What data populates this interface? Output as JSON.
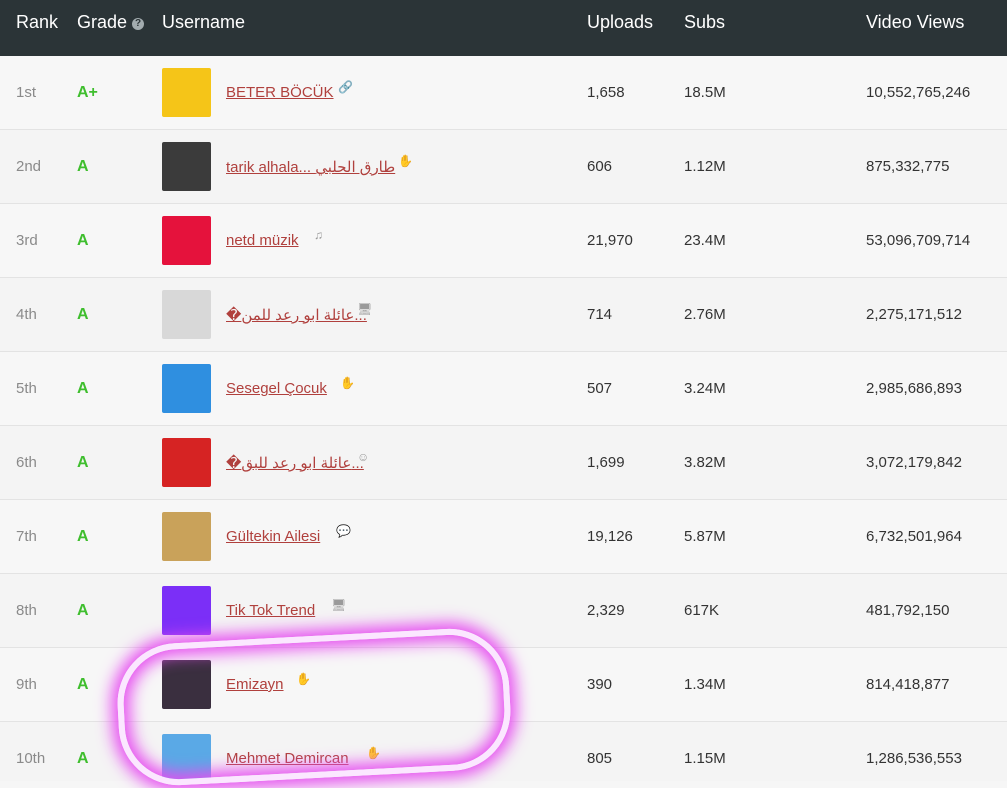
{
  "header": {
    "rank": "Rank",
    "grade": "Grade",
    "username": "Username",
    "uploads": "Uploads",
    "subs": "Subs",
    "views": "Video Views"
  },
  "rows": [
    {
      "rank": "1st",
      "grade": "A+",
      "username": "BETER BÖCÜK",
      "uploads": "1,658",
      "subs": "18.5M",
      "views": "10,552,765,246",
      "category_icon": "link-icon",
      "avatar_color": "#f5c518"
    },
    {
      "rank": "2nd",
      "grade": "A",
      "username": "tarik alhala... طارق الحلبي",
      "uploads": "606",
      "subs": "1.12M",
      "views": "875,332,775",
      "category_icon": "hand-icon",
      "avatar_color": "#3b3b3b"
    },
    {
      "rank": "3rd",
      "grade": "A",
      "username": "netd müzik",
      "uploads": "21,970",
      "subs": "23.4M",
      "views": "53,096,709,714",
      "category_icon": "music-icon",
      "avatar_color": "#e5123c"
    },
    {
      "rank": "4th",
      "grade": "A",
      "username": "�عائلة ابو رعد للمن...",
      "uploads": "714",
      "subs": "2.76M",
      "views": "2,275,171,512",
      "category_icon": "monitor-icon",
      "avatar_color": "#d8d8d8"
    },
    {
      "rank": "5th",
      "grade": "A",
      "username": "Sesegel Çocuk",
      "uploads": "507",
      "subs": "3.24M",
      "views": "2,985,686,893",
      "category_icon": "hand-icon",
      "avatar_color": "#2f8fe0"
    },
    {
      "rank": "6th",
      "grade": "A",
      "username": "�عائلة ابو رعد للبق...",
      "uploads": "1,699",
      "subs": "3.82M",
      "views": "3,072,179,842",
      "category_icon": "smile-icon",
      "avatar_color": "#d62323"
    },
    {
      "rank": "7th",
      "grade": "A",
      "username": "Gültekin Ailesi",
      "uploads": "19,126",
      "subs": "5.87M",
      "views": "6,732,501,964",
      "category_icon": "chat-icon",
      "avatar_color": "#c9a25a"
    },
    {
      "rank": "8th",
      "grade": "A",
      "username": "Tik Tok Trend",
      "uploads": "2,329",
      "subs": "617K",
      "views": "481,792,150",
      "category_icon": "monitor-icon",
      "avatar_color": "#7b2ff7"
    },
    {
      "rank": "9th",
      "grade": "A",
      "username": "Emizayn",
      "uploads": "390",
      "subs": "1.34M",
      "views": "814,418,877",
      "category_icon": "hand-icon",
      "avatar_color": "#3a2f3f"
    },
    {
      "rank": "10th",
      "grade": "A",
      "username": "Mehmet Demircan",
      "uploads": "805",
      "subs": "1.15M",
      "views": "1,286,536,553",
      "category_icon": "hand-icon",
      "avatar_color": "#5aa9e6"
    }
  ]
}
